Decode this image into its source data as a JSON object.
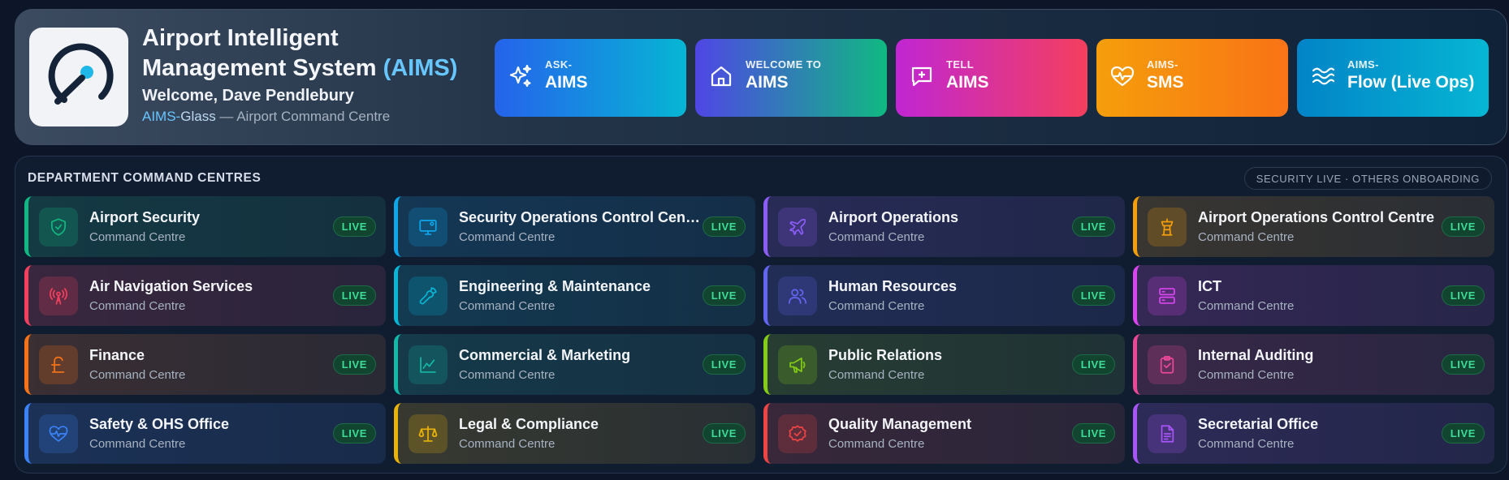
{
  "header": {
    "title_line1": "Airport Intelligent",
    "title_line2": "Management System",
    "title_accent": "(AIMS)",
    "welcome": "Welcome, Dave Pendlebury",
    "sub_brand_a": "AIMS-",
    "sub_brand_b": "Glass",
    "sub_rest": " — Airport Command Centre"
  },
  "quick_actions": [
    {
      "small": "ASK-",
      "big": "AIMS",
      "icon": "sparkles-icon"
    },
    {
      "small": "WELCOME TO",
      "big": "AIMS",
      "icon": "home-icon"
    },
    {
      "small": "TELL",
      "big": "AIMS",
      "icon": "message-plus-icon"
    },
    {
      "small": "AIMS-",
      "big": "SMS",
      "icon": "heart-pulse-icon"
    },
    {
      "small": "AIMS-",
      "big": "Flow (Live Ops)",
      "icon": "waves-icon"
    }
  ],
  "departments": {
    "title": "DEPARTMENT COMMAND CENTRES",
    "badge": "SECURITY LIVE · OTHERS ONBOARDING",
    "items": [
      {
        "name": "Airport Security",
        "sub": "Command Centre",
        "status": "LIVE",
        "icon": "shield-icon",
        "color": "#10b981"
      },
      {
        "name": "Security Operations Control Centre",
        "sub": "Command Centre",
        "status": "LIVE",
        "icon": "monitor-icon",
        "color": "#0ea5e9"
      },
      {
        "name": "Airport Operations",
        "sub": "Command Centre",
        "status": "LIVE",
        "icon": "plane-icon",
        "color": "#8b5cf6"
      },
      {
        "name": "Airport Operations Control Centre",
        "sub": "Command Centre",
        "status": "LIVE",
        "icon": "control-tower-icon",
        "color": "#f59e0b"
      },
      {
        "name": "Air Navigation Services",
        "sub": "Command Centre",
        "status": "LIVE",
        "icon": "radio-tower-icon",
        "color": "#f43f5e"
      },
      {
        "name": "Engineering & Maintenance",
        "sub": "Command Centre",
        "status": "LIVE",
        "icon": "wrench-icon",
        "color": "#06b6d4"
      },
      {
        "name": "Human Resources",
        "sub": "Command Centre",
        "status": "LIVE",
        "icon": "users-icon",
        "color": "#6366f1"
      },
      {
        "name": "ICT",
        "sub": "Command Centre",
        "status": "LIVE",
        "icon": "server-icon",
        "color": "#d946ef"
      },
      {
        "name": "Finance",
        "sub": "Command Centre",
        "status": "LIVE",
        "icon": "pound-icon",
        "color": "#f97316"
      },
      {
        "name": "Commercial & Marketing",
        "sub": "Command Centre",
        "status": "LIVE",
        "icon": "chart-line-icon",
        "color": "#14b8a6"
      },
      {
        "name": "Public Relations",
        "sub": "Command Centre",
        "status": "LIVE",
        "icon": "megaphone-icon",
        "color": "#84cc16"
      },
      {
        "name": "Internal Auditing",
        "sub": "Command Centre",
        "status": "LIVE",
        "icon": "clipboard-check-icon",
        "color": "#ec4899"
      },
      {
        "name": "Safety & OHS Office",
        "sub": "Command Centre",
        "status": "LIVE",
        "icon": "heart-pulse-icon",
        "color": "#3b82f6"
      },
      {
        "name": "Legal & Compliance",
        "sub": "Command Centre",
        "status": "LIVE",
        "icon": "scale-icon",
        "color": "#eab308"
      },
      {
        "name": "Quality Management",
        "sub": "Command Centre",
        "status": "LIVE",
        "icon": "badge-check-icon",
        "color": "#ef4444"
      },
      {
        "name": "Secretarial Office",
        "sub": "Command Centre",
        "status": "LIVE",
        "icon": "file-text-icon",
        "color": "#a855f7"
      }
    ]
  }
}
